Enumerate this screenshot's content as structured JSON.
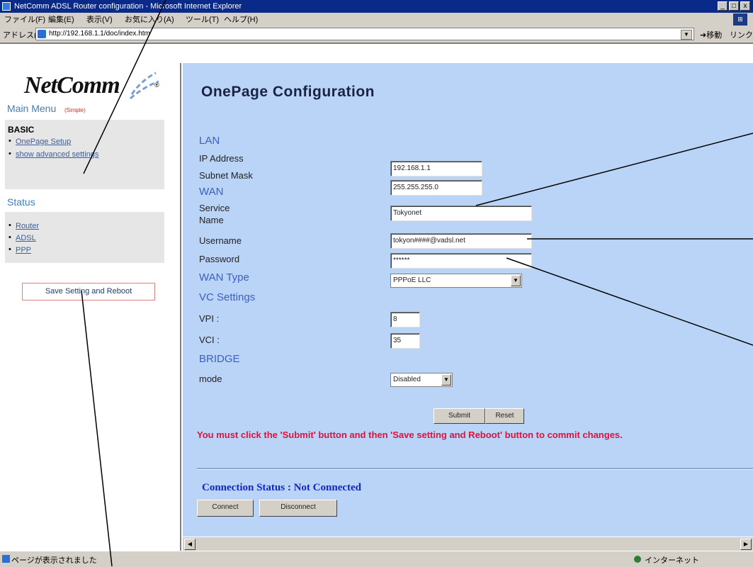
{
  "window": {
    "title": "NetComm ADSL Router configuration - Microsoft Internet Explorer",
    "controls": [
      "_",
      "□",
      "x"
    ]
  },
  "menubar": {
    "items": [
      "ファイル(F)",
      "編集(E)",
      "表示(V)",
      "お気に入り(A)",
      "ツール(T)",
      "ヘルプ(H)"
    ]
  },
  "addressbar": {
    "label": "アドレス(D)",
    "url": "http://192.168.1.1/doc/index.htm",
    "go": "移動",
    "links": "リンク »"
  },
  "sidebar": {
    "logo": "NetComm",
    "reg": "®",
    "main_menu": "Main Menu",
    "simple": "(Simple)",
    "basic_title": "BASIC",
    "basic_links": [
      "OnePage Setup",
      "show advanced settings"
    ],
    "status_title": "Status",
    "status_links": [
      "Router",
      "ADSL",
      "PPP"
    ],
    "save_button": "Save Setting and Reboot"
  },
  "config": {
    "title": "OnePage Configuration",
    "lan": "LAN",
    "ip_label": "IP Address",
    "ip_value": "192.168.1.1",
    "mask_label": "Subnet Mask",
    "mask_value": "255.255.255.0",
    "wan": "WAN",
    "service_label": "Service Name",
    "service_value": "Tokyonet",
    "username_label": "Username",
    "username_value": "tokyon####@vadsl.net",
    "password_label": "Password",
    "password_value": "******",
    "wantype_label": "WAN Type",
    "wantype_value": "PPPoE LLC",
    "vc_settings": "VC Settings",
    "vpi_label": "VPI :",
    "vpi_value": "8",
    "vci_label": "VCI :",
    "vci_value": "35",
    "bridge": "BRIDGE",
    "mode_label": "mode",
    "mode_value": "Disabled",
    "submit": "Submit",
    "reset": "Reset",
    "warning": "You must click the 'Submit' button and then 'Save setting and Reboot' button to commit changes.",
    "connection_status": "Connection Status : Not Connected",
    "connect": "Connect",
    "disconnect": "Disconnect"
  },
  "statusbar": {
    "message": "ページが表示されました",
    "zone": "インターネット"
  }
}
